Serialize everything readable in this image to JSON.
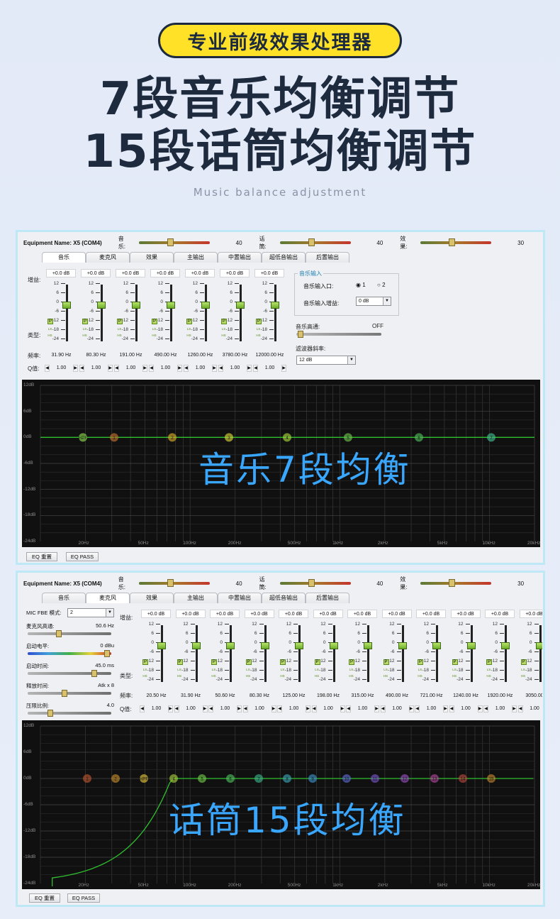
{
  "header": {
    "badge": "专业前级效果处理器",
    "title_line1": "7段音乐均衡调节",
    "title_line2": "15段话筒均衡调节",
    "subtitle": "Music balance adjustment"
  },
  "topbar": {
    "equipment": "Equipment Name: X5 (COM4)",
    "music_label": "音乐:",
    "music_value": "40",
    "mic_label": "话筒:",
    "mic_value": "40",
    "effect_label": "效果:",
    "effect_value": "30",
    "music_level": 0.4,
    "mic_level": 0.4,
    "effect_level": 0.3
  },
  "tabs": [
    "音乐",
    "麦克风",
    "效果",
    "主输出",
    "中置输出",
    "超低音输出",
    "后置输出"
  ],
  "labels": {
    "gain": "增益:",
    "type": "类型:",
    "freq": "频率:",
    "q": "Q值:"
  },
  "scale": [
    "12",
    "6",
    "0",
    "-6",
    "-12",
    "-18",
    "-24"
  ],
  "type_tags": [
    "P",
    "LS",
    "HS"
  ],
  "music_eq": {
    "gain": [
      "+0.0 dB",
      "+0.0 dB",
      "+0.0 dB",
      "+0.0 dB",
      "+0.0 dB",
      "+0.0 dB",
      "+0.0 dB"
    ],
    "freq": [
      "31.90 Hz",
      "80.30 Hz",
      "191.00 Hz",
      "490.00 Hz",
      "1260.00 Hz",
      "3780.00 Hz",
      "12000.00 Hz"
    ],
    "q": [
      "1.00",
      "1.00",
      "1.00",
      "1.00",
      "1.00",
      "1.00",
      "1.00"
    ]
  },
  "music_input": {
    "group": "音乐输入",
    "port_label": "音乐输入口:",
    "port1": "1",
    "port2": "2",
    "gain_label": "音乐输入增益:",
    "gain_value": "0 dB",
    "hp_label": "音乐高通:",
    "hp_value": "OFF",
    "slope_label": "滤波器斜率:",
    "slope_value": "12 dB"
  },
  "graph": {
    "y_labels": [
      "12dB",
      "6dB",
      "0dB",
      "-6dB",
      "-12dB",
      "-18dB",
      "-24dB"
    ],
    "x_labels": [
      "20Hz",
      "50Hz",
      "100Hz",
      "200Hz",
      "500Hz",
      "1kHz",
      "2kHz",
      "5kHz",
      "10kHz",
      "20kHz"
    ],
    "music_points": [
      "HPF",
      "1",
      "2",
      "3",
      "4",
      "5",
      "6",
      "7"
    ],
    "mic_points": [
      "1",
      "2",
      "HPF",
      "4",
      "5",
      "6",
      "7",
      "8",
      "9",
      "10",
      "11",
      "12",
      "13",
      "14",
      "15"
    ],
    "music_overlay": "音乐7段均衡",
    "mic_overlay": "话筒15段均衡",
    "line_color": "#2fbf2f"
  },
  "buttons": {
    "reset": "EQ 重置",
    "pass": "EQ PASS"
  },
  "mic_panel": {
    "mode_label": "MIC FBE 模式:",
    "mode_value": "2",
    "hp_label": "麦克风高通:",
    "hp_value": "50.6 Hz",
    "start_label": "启动电平:",
    "start_value": "0 dBu",
    "attack_label": "启动时间:",
    "attack_value": "45.0 ms",
    "release_label": "释放时间:",
    "release_value": "Atk x 8",
    "ratio_label": "压限比例:",
    "ratio_value": "4.0"
  },
  "mic_eq": {
    "gain": [
      "+0.0 dB",
      "+0.0 dB",
      "+0.0 dB",
      "+0.0 dB",
      "+0.0 dB",
      "+0.0 dB",
      "+0.0 dB",
      "+0.0 dB",
      "+0.0 dB",
      "+0.0 dB",
      "+0.0 dB",
      "+0.0 dB",
      "+0.0 d"
    ],
    "freq": [
      "20.50 Hz",
      "31.90 Hz",
      "50.60 Hz",
      "80.30 Hz",
      "125.00 Hz",
      "198.00 Hz",
      "315.00 Hz",
      "490.00 Hz",
      "721.00 Hz",
      "1240.00 Hz",
      "1920.00 Hz",
      "3050.00"
    ],
    "q": [
      "1.00",
      "1.00",
      "1.00",
      "1.00",
      "1.00",
      "1.00",
      "1.00",
      "1.00",
      "1.00",
      "1.00",
      "1.00",
      "1.00"
    ]
  }
}
